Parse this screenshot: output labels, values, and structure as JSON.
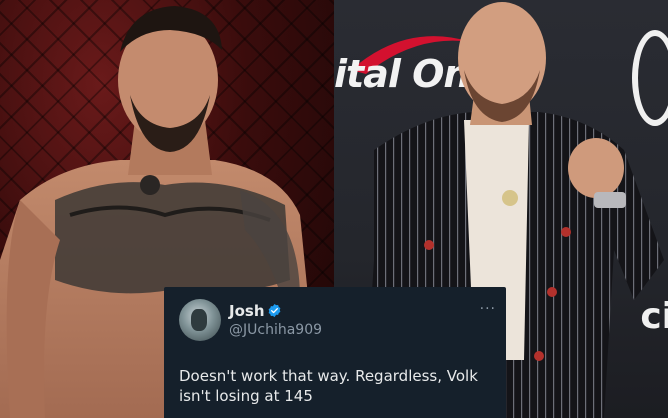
{
  "left_photo": {
    "subject": "shirtless-fighter-with-chest-tattoos"
  },
  "right_photo": {
    "subject": "man-in-pinstripe-suit-raising-fist",
    "backdrop_logo_text": "ital One",
    "backdrop_logo_text_right": "ci"
  },
  "tweet": {
    "display_name": "Josh",
    "handle": "@JUchiha909",
    "more_label": "···",
    "text": "Doesn't work that way. Regardless, Volk isn't losing at 145"
  },
  "colors": {
    "card_background": "#15202b",
    "verified_blue": "#1d9bf0",
    "name_text": "#e7e9ea",
    "muted_text": "#8b98a5",
    "brand_red": "#d3112f"
  }
}
